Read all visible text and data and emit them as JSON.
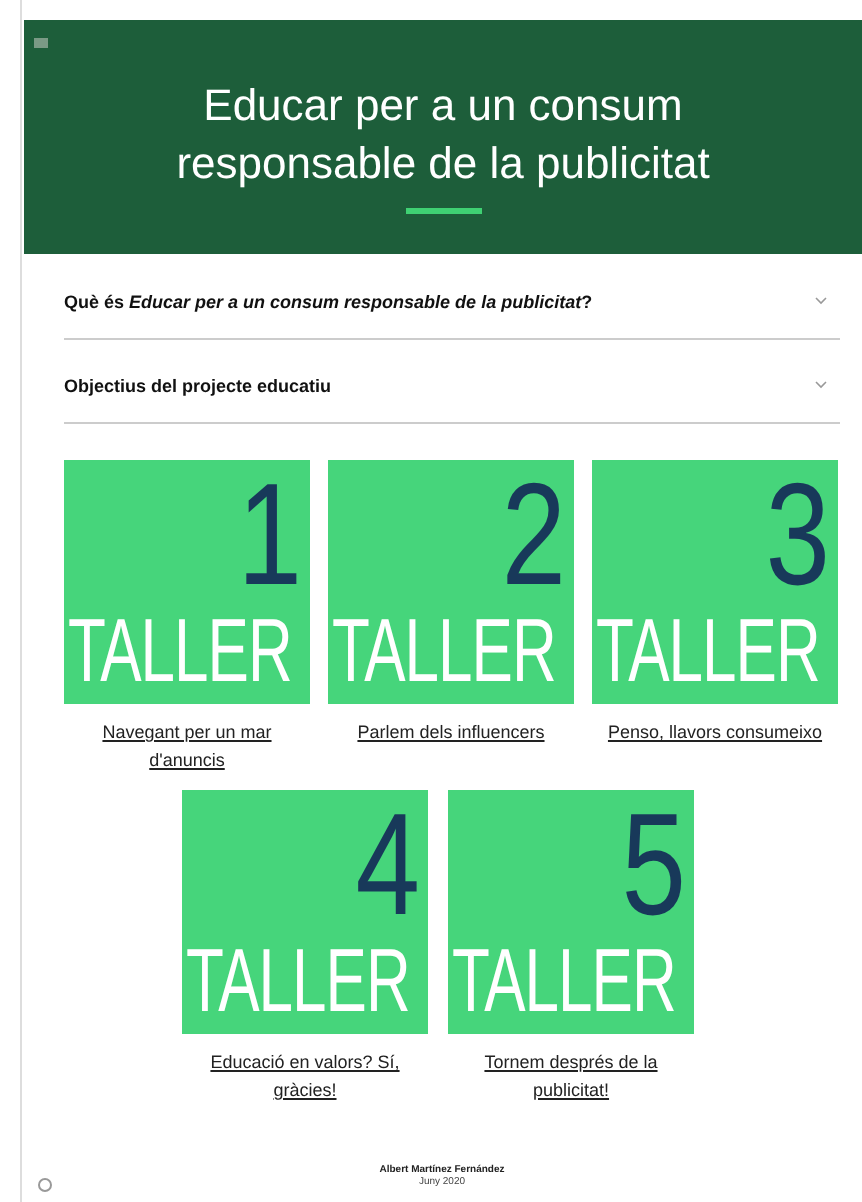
{
  "header": {
    "title": "Educar per a un consum responsable de la publicitat"
  },
  "accordions": [
    {
      "title": "Què és *Educar per a un consum responsable de la publicitat*?",
      "expanded": false
    },
    {
      "title": "Objectius del projecte educatiu",
      "expanded": false
    }
  ],
  "workshops": [
    {
      "number": "1",
      "word": "TALLER",
      "caption": "Navegant per un mar d'anuncis"
    },
    {
      "number": "2",
      "word": "TALLER",
      "caption": "Parlem dels influencers"
    },
    {
      "number": "3",
      "word": "TALLER",
      "caption": "Penso, llavors consumeixo"
    },
    {
      "number": "4",
      "word": "TALLER",
      "caption": "Educació en valors? Sí, gràcies!"
    },
    {
      "number": "5",
      "word": "TALLER",
      "caption": "Tornem després de la publicitat!"
    }
  ],
  "footer": {
    "author": "Albert Martínez Fernández",
    "date": "Juny 2020"
  }
}
